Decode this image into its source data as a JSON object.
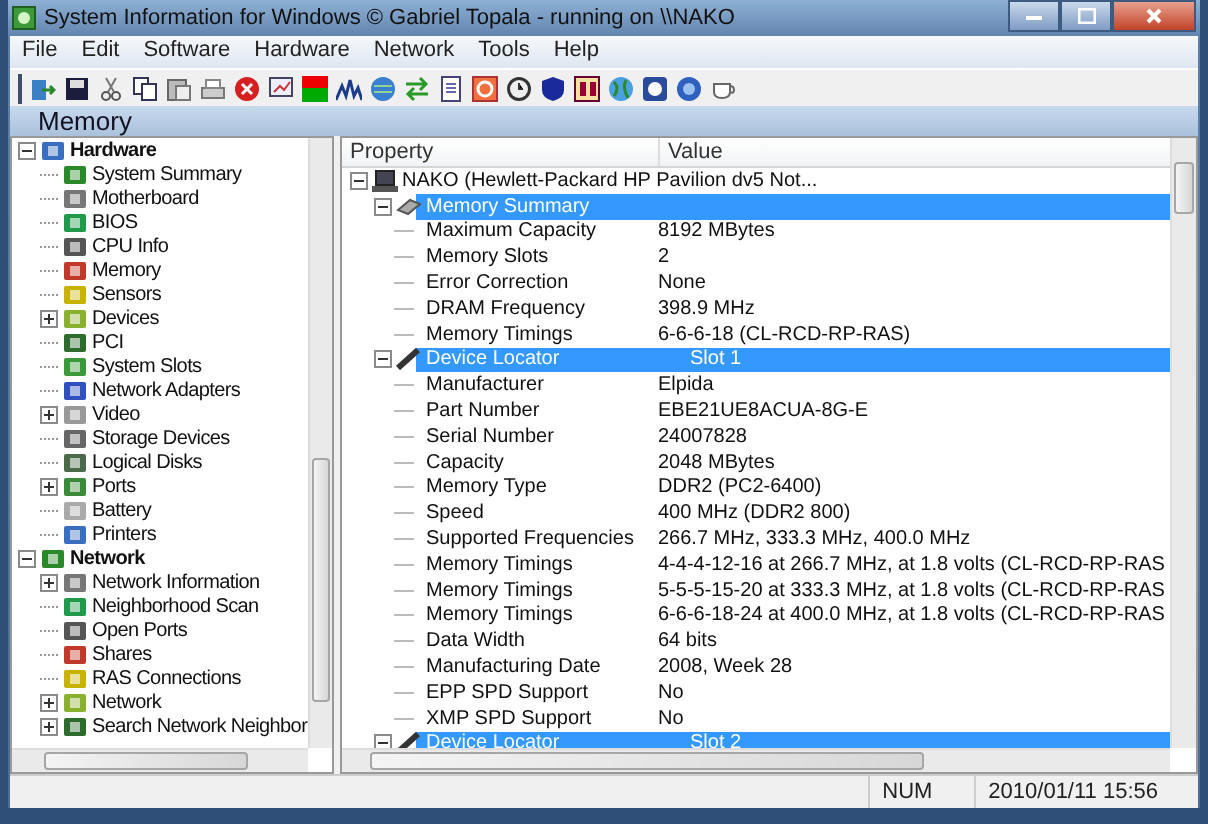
{
  "window": {
    "title": "System Information for Windows  © Gabriel Topala - running on \\\\NAKO"
  },
  "menu": [
    "File",
    "Edit",
    "Software",
    "Hardware",
    "Network",
    "Tools",
    "Help"
  ],
  "section_title": "Memory",
  "sidebar": {
    "items": [
      {
        "label": "Hardware",
        "expanded": true,
        "children": [
          {
            "label": "System Summary"
          },
          {
            "label": "Motherboard"
          },
          {
            "label": "BIOS"
          },
          {
            "label": "CPU Info"
          },
          {
            "label": "Memory"
          },
          {
            "label": "Sensors"
          },
          {
            "label": "Devices",
            "expanded": false
          },
          {
            "label": "PCI"
          },
          {
            "label": "System Slots"
          },
          {
            "label": "Network Adapters"
          },
          {
            "label": "Video",
            "expanded": false
          },
          {
            "label": "Storage Devices"
          },
          {
            "label": "Logical Disks"
          },
          {
            "label": "Ports",
            "expanded": false
          },
          {
            "label": "Battery"
          },
          {
            "label": "Printers"
          }
        ]
      },
      {
        "label": "Network",
        "expanded": true,
        "children": [
          {
            "label": "Network Information",
            "expanded": false
          },
          {
            "label": "Neighborhood Scan"
          },
          {
            "label": "Open Ports"
          },
          {
            "label": "Shares"
          },
          {
            "label": "RAS Connections"
          },
          {
            "label": "Network",
            "expanded": false
          },
          {
            "label": "Search Network Neighbor",
            "expanded": false
          }
        ]
      }
    ]
  },
  "table": {
    "columns": [
      "Property",
      "Value"
    ],
    "root": {
      "label": "NAKO (Hewlett-Packard HP Pavilion dv5 Not...",
      "expanded": true
    },
    "groups": [
      {
        "property": "Memory Summary",
        "expanded": true,
        "rows": [
          {
            "property": "Maximum Capacity",
            "value": "8192 MBytes"
          },
          {
            "property": "Memory Slots",
            "value": "2"
          },
          {
            "property": "Error Correction",
            "value": "None"
          },
          {
            "property": "DRAM Frequency",
            "value": "398.9 MHz"
          },
          {
            "property": "Memory Timings",
            "value": "6-6-6-18 (CL-RCD-RP-RAS)"
          }
        ]
      },
      {
        "property": "Device Locator",
        "value": "Slot 1",
        "expanded": true,
        "rows": [
          {
            "property": "Manufacturer",
            "value": "Elpida"
          },
          {
            "property": "Part Number",
            "value": "EBE21UE8ACUA-8G-E"
          },
          {
            "property": "Serial Number",
            "value": "24007828"
          },
          {
            "property": "Capacity",
            "value": "2048 MBytes"
          },
          {
            "property": "Memory Type",
            "value": "DDR2 (PC2-6400)"
          },
          {
            "property": "Speed",
            "value": "400 MHz (DDR2 800)"
          },
          {
            "property": "Supported Frequencies",
            "value": "266.7 MHz, 333.3 MHz, 400.0 MHz"
          },
          {
            "property": "Memory Timings",
            "value": "4-4-4-12-16 at 266.7 MHz, at 1.8 volts (CL-RCD-RP-RAS"
          },
          {
            "property": "Memory Timings",
            "value": "5-5-5-15-20 at 333.3 MHz, at 1.8 volts (CL-RCD-RP-RAS"
          },
          {
            "property": "Memory Timings",
            "value": "6-6-6-18-24 at 400.0 MHz, at 1.8 volts (CL-RCD-RP-RAS"
          },
          {
            "property": "Data Width",
            "value": "64 bits"
          },
          {
            "property": "Manufacturing Date",
            "value": "2008, Week 28"
          },
          {
            "property": "EPP SPD Support",
            "value": "No"
          },
          {
            "property": "XMP SPD Support",
            "value": "No"
          }
        ]
      },
      {
        "property": "Device Locator",
        "value": "Slot 2",
        "expanded": true
      }
    ]
  },
  "status_bar": {
    "indicator": "NUM",
    "datetime": "2010/01/11 15:56"
  }
}
